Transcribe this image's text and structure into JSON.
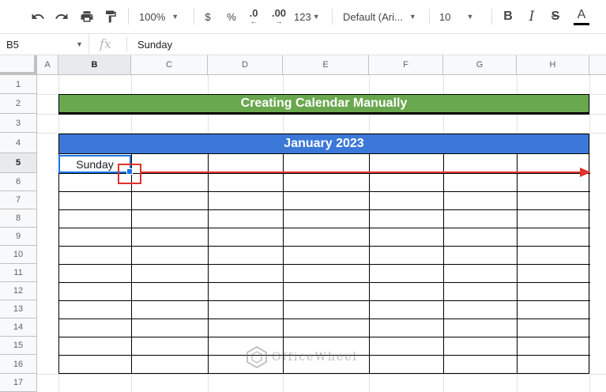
{
  "toolbar": {
    "zoom": "100%",
    "currency": "$",
    "percent": "%",
    "decrease_decimals": ".0",
    "increase_decimals": ".00",
    "more_formats": "123",
    "font": "Default (Ari...",
    "font_size": "10",
    "bold": "B",
    "italic": "I",
    "strikethrough": "S",
    "text_color": "A"
  },
  "formula_bar": {
    "name_box": "B5",
    "fx_label": "fx",
    "value": "Sunday"
  },
  "columns": [
    "A",
    "B",
    "C",
    "D",
    "E",
    "F",
    "G",
    "H"
  ],
  "rows": [
    "1",
    "2",
    "3",
    "4",
    "5",
    "6",
    "7",
    "8",
    "9",
    "10",
    "11",
    "12",
    "13",
    "14",
    "15",
    "16",
    "17"
  ],
  "sheet": {
    "title": "Creating Calendar Manually",
    "month": "January 2023",
    "b5": "Sunday",
    "selected_cell": "B5",
    "title_color": "#6aa84f",
    "month_color": "#3c78d8",
    "selection_color": "#1a73e8",
    "highlight_color": "#e0322e"
  },
  "watermark": {
    "text": "OfficeWheel"
  }
}
